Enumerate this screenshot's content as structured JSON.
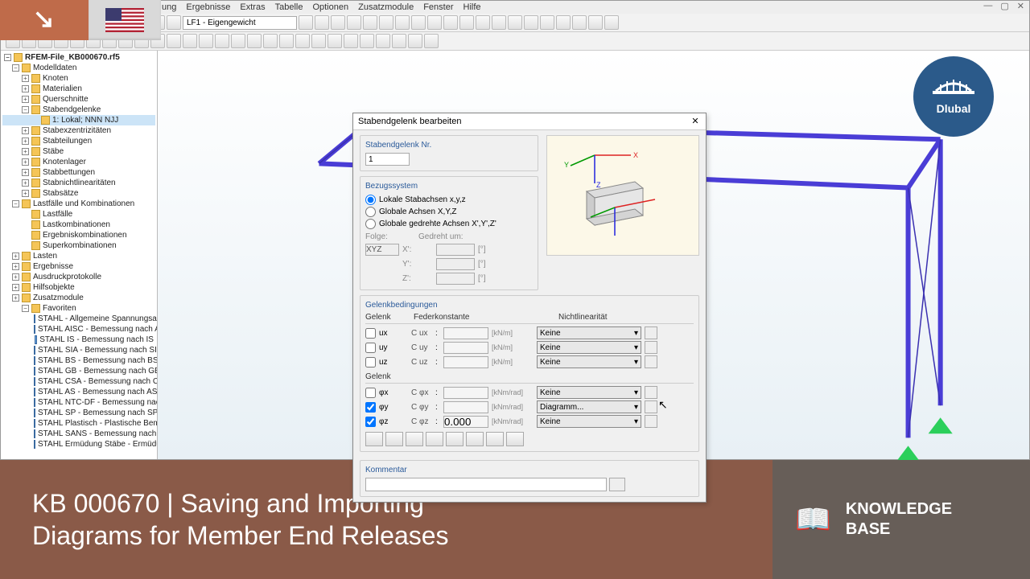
{
  "menubar": [
    "ung",
    "Ergebnisse",
    "Extras",
    "Tabelle",
    "Optionen",
    "Zusatzmodule",
    "Fenster",
    "Hilfe"
  ],
  "toolbar": {
    "load_combo": "LF1 - Eigengewicht"
  },
  "tree": {
    "root": "RFEM-File_KB000670.rf5",
    "modelldaten": "Modelldaten",
    "modelldaten_items": [
      "Knoten",
      "Materialien",
      "Querschnitte"
    ],
    "stabendgelenke": "Stabendgelenke",
    "stabendgelenke_sel": "1: Lokal; NNN NJJ",
    "mid_items": [
      "Stabexzentrizitäten",
      "Stabteilungen",
      "Stäbe",
      "Knotenlager",
      "Stabbettungen",
      "Stabnichtlinearitäten",
      "Stabsätze"
    ],
    "lastfaelle": "Lastfälle und Kombinationen",
    "lastfaelle_items": [
      "Lastfälle",
      "Lastkombinationen",
      "Ergebniskombinationen",
      "Superkombinationen"
    ],
    "more": [
      "Lasten",
      "Ergebnisse",
      "Ausdruckprotokolle",
      "Hilfsobjekte",
      "Zusatzmodule"
    ],
    "fav": "Favoriten",
    "fav_items": [
      "STAHL - Allgemeine Spannungsanalyse",
      "STAHL AISC - Bemessung nach AISC",
      "STAHL IS - Bemessung nach IS",
      "STAHL SIA - Bemessung nach SIA",
      "STAHL BS - Bemessung nach BS",
      "STAHL GB - Bemessung nach GB",
      "STAHL CSA - Bemessung nach CSA",
      "STAHL AS - Bemessung nach AS",
      "STAHL NTC-DF - Bemessung nach NTC",
      "STAHL SP - Bemessung nach SP",
      "STAHL Plastisch - Plastische Bemessun",
      "STAHL SANS - Bemessung nach SANS",
      "STAHL Ermüdung Stäbe - Ermüdungs"
    ]
  },
  "dialog": {
    "title": "Stabendgelenk bearbeiten",
    "nr_label": "Stabendgelenk Nr.",
    "nr_value": "1",
    "bezug_title": "Bezugssystem",
    "r1": "Lokale Stabachsen x,y,z",
    "r2": "Globale Achsen X,Y,Z",
    "r3": "Globale gedrehte Achsen X',Y',Z'",
    "folge": "Folge:",
    "folge_val": "XYZ",
    "gedreht": "Gedreht um:",
    "axes_x": "X':",
    "axes_y": "Y':",
    "axes_z": "Z':",
    "deg_unit": "[°]",
    "cond_title": "Gelenkbedingungen",
    "col_gelenk": "Gelenk",
    "col_feder": "Federkonstante",
    "col_nl": "Nichtlinearität",
    "rows_trans": [
      {
        "chk": false,
        "lbl": "ux",
        "c": "C ux",
        "unit": "[kN/m]",
        "nl": "Keine"
      },
      {
        "chk": false,
        "lbl": "uy",
        "c": "C uy",
        "unit": "[kN/m]",
        "nl": "Keine"
      },
      {
        "chk": false,
        "lbl": "uz",
        "c": "C uz",
        "unit": "[kN/m]",
        "nl": "Keine"
      }
    ],
    "rows_rot": [
      {
        "chk": false,
        "lbl": "φx",
        "c": "C φx",
        "unit": "[kNm/rad]",
        "nl": "Keine"
      },
      {
        "chk": true,
        "lbl": "φy",
        "c": "C φy",
        "unit": "[kNm/rad]",
        "nl": "Diagramm..."
      },
      {
        "chk": true,
        "lbl": "φz",
        "c": "C φz",
        "val": "0.000",
        "unit": "[kNm/rad]",
        "nl": "Keine"
      }
    ],
    "kommentar": "Kommentar"
  },
  "banner": {
    "l1": "KB 000670 | Saving and Importing",
    "l2": "Diagrams for Member End Releases",
    "kb1": "KNOWLEDGE",
    "kb2": "BASE",
    "book": "📖"
  },
  "logo": {
    "name": "Dlubal"
  }
}
